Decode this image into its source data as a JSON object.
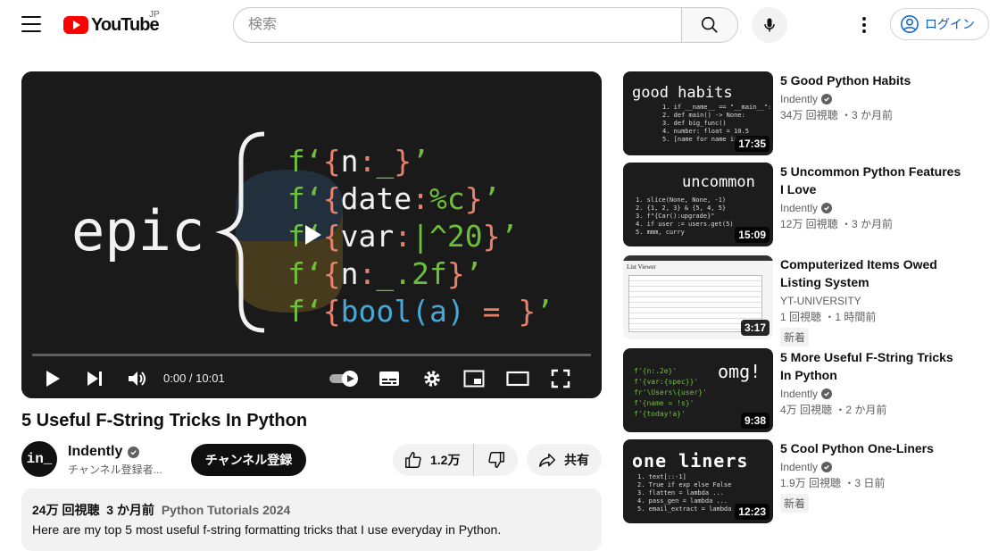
{
  "header": {
    "logo_text": "YouTube",
    "region": "JP",
    "search_placeholder": "検索",
    "login_label": "ログイン"
  },
  "video": {
    "title": "5 Useful F-String Tricks In Python",
    "thumbnail_word": "epic",
    "code_lines": [
      {
        "pre": "f‘",
        "brace": "{",
        "body": "n",
        "colon": ":",
        "spec": "_",
        "close": "}",
        "end": "’"
      },
      {
        "pre": "f‘",
        "brace": "{",
        "body": "date",
        "colon": ":",
        "spec": "%c",
        "close": "}",
        "end": "’"
      },
      {
        "pre": "f‘",
        "brace": "{",
        "body": "var",
        "colon": ":",
        "spec": "|^20",
        "close": "}",
        "end": "’"
      },
      {
        "pre": "f‘",
        "brace": "{",
        "body": "n",
        "colon": ":",
        "spec": "_.2f",
        "close": "}",
        "end": "’"
      },
      {
        "pre": "f‘",
        "brace": "{",
        "body": "bool(a)",
        "colon": " = ",
        "spec": "",
        "close": "}",
        "end": "’"
      }
    ],
    "progress": 0,
    "time_current": "0:00",
    "time_total": "10:01",
    "time_display": "0:00 / 10:01"
  },
  "channel": {
    "name": "Indently",
    "avatar_text": "in_",
    "subscribers": "チャンネル登録者...",
    "subscribe_label": "チャンネル登録"
  },
  "actions": {
    "likes": "1.2万",
    "share_label": "共有"
  },
  "description": {
    "views": "24万 回視聴",
    "age": "3 か月前",
    "tag": "Python Tutorials 2024",
    "text": "Here are my top 5 most useful f-string formatting tricks that I use everyday in Python."
  },
  "recommendations": [
    {
      "title": "5 Good Python Habits",
      "channel": "Indently",
      "verified": true,
      "meta": "34万 回視聴 ・3 か月前",
      "duration": "17:35",
      "thumb_heading": "good habits",
      "thumb_lines": [
        "1. if __name__ == \"__main__\":",
        "2. def main() -> None:",
        "3. def big_func()",
        "4. number: float = 10.5",
        "5. [name for name in names]"
      ],
      "badge": ""
    },
    {
      "title": "5 Uncommon Python Features I Love",
      "channel": "Indently",
      "verified": true,
      "meta": "12万 回視聴 ・3 か月前",
      "duration": "15:09",
      "thumb_heading": "uncommon",
      "thumb_lines": [
        "1. slice(None, None, -1)",
        "2. {1, 2, 3} & {5, 4, 5}",
        "3. f\"{Car():upgrade}\"",
        "4. if user := users.get(5)",
        "5. mmm, curry"
      ],
      "badge": ""
    },
    {
      "title": "Computerized Items Owed Listing System",
      "channel": "YT-UNIVERSITY",
      "verified": false,
      "meta": "1 回視聴 ・1 時間前",
      "duration": "3:17",
      "thumb_heading": "List Viewer",
      "thumb_lines": [],
      "badge": "新着"
    },
    {
      "title": "5 More Useful F-String Tricks In Python",
      "channel": "Indently",
      "verified": true,
      "meta": "4万 回視聴 ・2 か月前",
      "duration": "9:38",
      "thumb_heading": "omg!",
      "thumb_lines": [
        "f'{n:.2e}'",
        "f'{var:{spec}}'",
        "fr'\\Users\\{user}'",
        "f'{name = !s}'",
        "f'{today!a}'"
      ],
      "badge": ""
    },
    {
      "title": "5 Cool Python One-Liners",
      "channel": "Indently",
      "verified": true,
      "meta": "1.9万 回視聴 ・3 日前",
      "duration": "12:23",
      "thumb_heading": "one liners",
      "thumb_lines": [
        "1. text[::-1]",
        "2. True if exp else False",
        "3. flatten = lambda ...",
        "4. pass_gen = lambda ...",
        "5. email_extract = lambda"
      ],
      "badge": "新着"
    }
  ]
}
